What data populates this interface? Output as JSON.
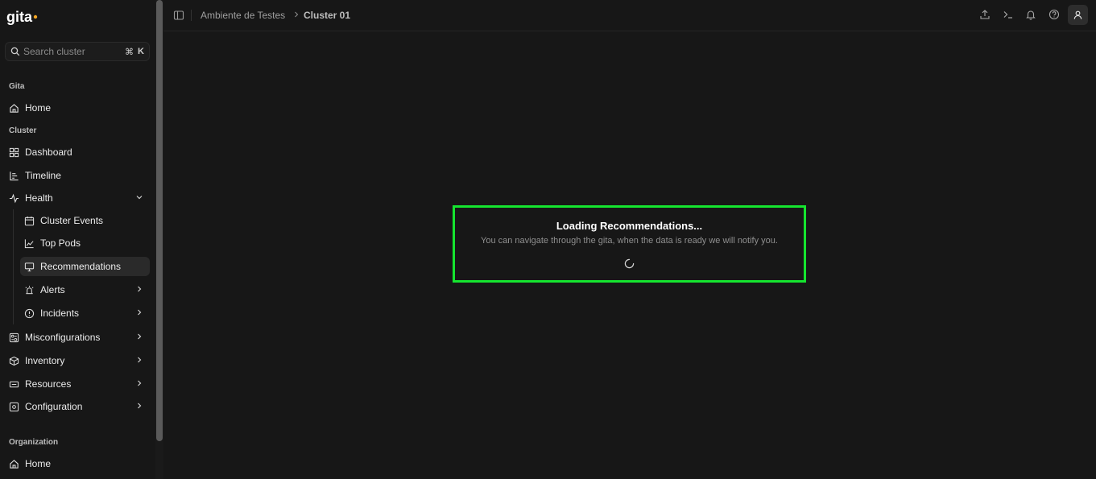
{
  "app": {
    "logo_text": "gita"
  },
  "search": {
    "placeholder": "Search cluster",
    "shortcut_symbol": "⌘",
    "shortcut_key": "K"
  },
  "sidebar": {
    "section_gita": "Gita",
    "home": "Home",
    "section_cluster": "Cluster",
    "dashboard": "Dashboard",
    "timeline": "Timeline",
    "health": "Health",
    "cluster_events": "Cluster Events",
    "top_pods": "Top Pods",
    "recommendations": "Recommendations",
    "alerts": "Alerts",
    "incidents": "Incidents",
    "misconfigurations": "Misconfigurations",
    "inventory": "Inventory",
    "resources": "Resources",
    "configuration": "Configuration",
    "section_org": "Organization",
    "org_home": "Home"
  },
  "breadcrumb": {
    "parent": "Ambiente de Testes",
    "current": "Cluster 01"
  },
  "loading": {
    "title": "Loading Recommendations...",
    "subtitle": "You can navigate through the gita, when the data is ready we will notify you."
  },
  "colors": {
    "highlight": "#15e52f",
    "background": "#171717"
  }
}
